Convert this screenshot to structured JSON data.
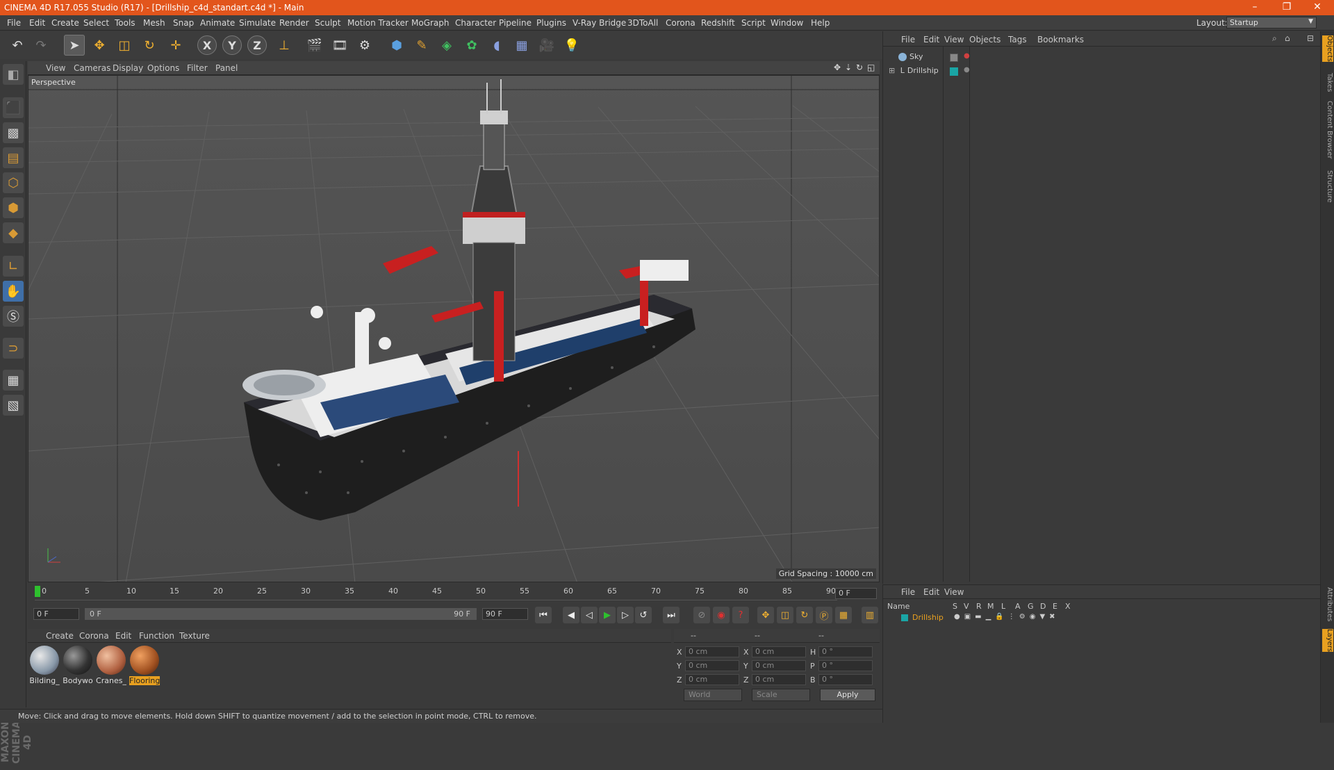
{
  "window": {
    "title": "CINEMA 4D R17.055 Studio (R17) - [Drillship_c4d_standart.c4d *] - Main",
    "controls": [
      "–",
      "❐",
      "✕"
    ]
  },
  "menu": [
    "File",
    "Edit",
    "Create",
    "Select",
    "Tools",
    "Mesh",
    "Snap",
    "Animate",
    "Simulate",
    "Render",
    "Sculpt",
    "Motion Tracker",
    "MoGraph",
    "Character",
    "Pipeline",
    "Plugins",
    "V-Ray Bridge",
    "3DToAll",
    "Corona",
    "Redshift",
    "Script",
    "Window",
    "Help"
  ],
  "layout": {
    "label": "Layout:",
    "value": "Startup"
  },
  "toolbar": {
    "axis": [
      "X",
      "Y",
      "Z"
    ]
  },
  "viewport": {
    "menu": [
      "View",
      "Cameras",
      "Display",
      "Options",
      "Filter",
      "Panel"
    ],
    "label": "Perspective",
    "grid_spacing": "Grid Spacing : 10000 cm"
  },
  "timeline": {
    "ticks": [
      "0",
      "5",
      "10",
      "15",
      "20",
      "25",
      "30",
      "35",
      "40",
      "45",
      "50",
      "55",
      "60",
      "65",
      "70",
      "75",
      "80",
      "85",
      "90"
    ],
    "current_frame": "0 F",
    "start_field": "0 F",
    "range_start": "0 F",
    "range_end": "90 F",
    "end_field": "90 F"
  },
  "materials": {
    "menu": [
      "Create",
      "Corona",
      "Edit",
      "Function",
      "Texture"
    ],
    "items": [
      {
        "label": "Bilding_"
      },
      {
        "label": "Bodywo"
      },
      {
        "label": "Cranes_"
      },
      {
        "label": "Flooring"
      }
    ]
  },
  "coords": {
    "header": [
      "--",
      "--",
      "--"
    ],
    "rows": [
      {
        "a": "X",
        "av": "0 cm",
        "b": "X",
        "bv": "0 cm",
        "c": "H",
        "cv": "0 °"
      },
      {
        "a": "Y",
        "av": "0 cm",
        "b": "Y",
        "bv": "0 cm",
        "c": "P",
        "cv": "0 °"
      },
      {
        "a": "Z",
        "av": "0 cm",
        "b": "Z",
        "bv": "0 cm",
        "c": "B",
        "cv": "0 °"
      }
    ],
    "world": "World",
    "scale": "Scale",
    "apply": "Apply"
  },
  "status": "Move: Click and drag to move elements. Hold down SHIFT to quantize movement / add to the selection in point mode, CTRL to remove.",
  "objects": {
    "menu": [
      "File",
      "Edit",
      "View",
      "Objects",
      "Tags",
      "Bookmarks"
    ],
    "items": [
      {
        "name": "Sky"
      },
      {
        "name": "Drillship"
      }
    ]
  },
  "layers": {
    "menu": [
      "File",
      "Edit",
      "View"
    ],
    "columns": [
      "Name",
      "S",
      "V",
      "R",
      "M",
      "L",
      "A",
      "G",
      "D",
      "E",
      "X"
    ],
    "row": "Drillship"
  },
  "side_tabs": [
    "Objects",
    "Takes",
    "Content Browser",
    "Structure"
  ],
  "side_tabs_bottom": [
    "Attributes",
    "Layers"
  ],
  "branding": "MAXON CINEMA 4D",
  "colors": {
    "title_bar": "#e2551c",
    "accent": "#e8a020",
    "layer_teal": "#1aa5a5"
  }
}
